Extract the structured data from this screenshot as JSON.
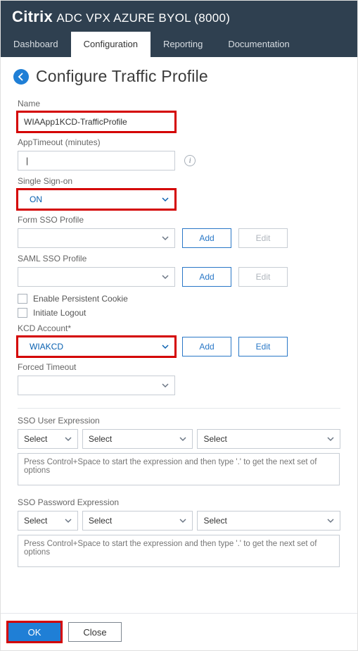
{
  "header": {
    "brand": "Citrix",
    "product": "ADC VPX AZURE BYOL (8000)"
  },
  "tabs": {
    "dashboard": "Dashboard",
    "configuration": "Configuration",
    "reporting": "Reporting",
    "documentation": "Documentation"
  },
  "page": {
    "title": "Configure Traffic Profile"
  },
  "form": {
    "name_label": "Name",
    "name_value": "WIAApp1KCD-TrafficProfile",
    "apptimeout_label": "AppTimeout (minutes)",
    "apptimeout_value": "",
    "sso_label": "Single Sign-on",
    "sso_value": "ON",
    "form_sso_label": "Form SSO Profile",
    "form_sso_value": "",
    "saml_sso_label": "SAML SSO Profile",
    "saml_sso_value": "",
    "add_btn": "Add",
    "edit_btn": "Edit",
    "persistent_cookie": "Enable Persistent Cookie",
    "initiate_logout": "Initiate Logout",
    "kcd_label": "KCD Account*",
    "kcd_value": "WIAKCD",
    "forced_timeout_label": "Forced Timeout",
    "forced_timeout_value": ""
  },
  "expr": {
    "user_label": "SSO User Expression",
    "pwd_label": "SSO Password Expression",
    "select": "Select",
    "hint": "Press Control+Space to start the expression and then type '.' to get the next set of options"
  },
  "footer": {
    "ok": "OK",
    "close": "Close"
  }
}
